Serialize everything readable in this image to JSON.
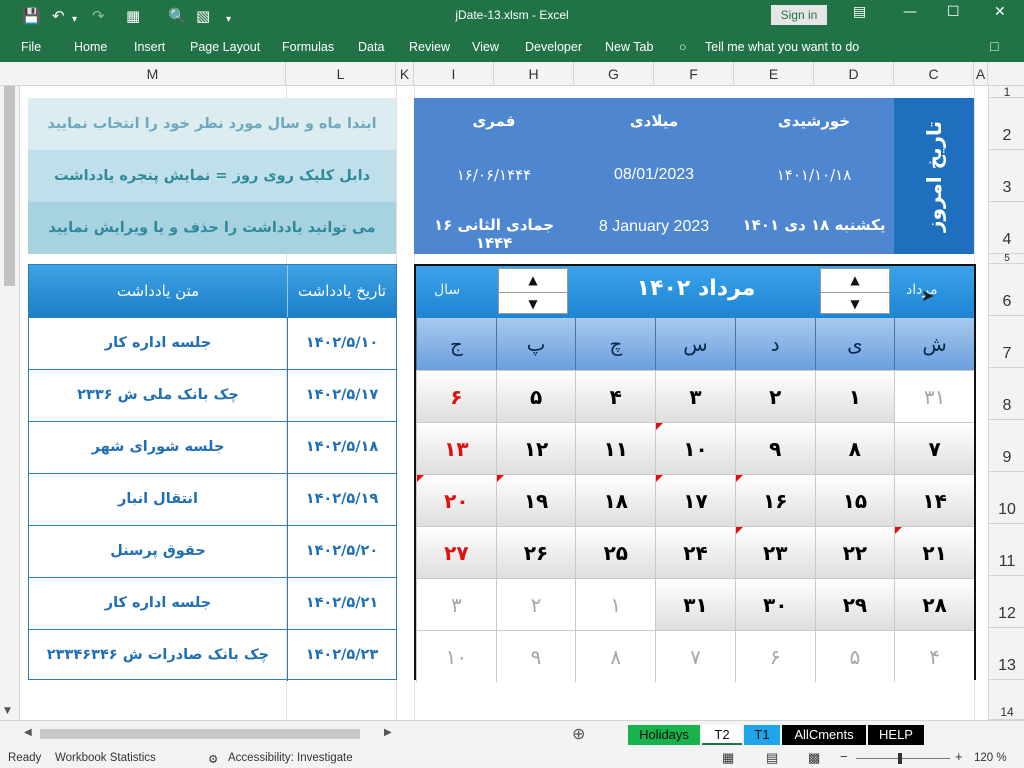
{
  "titlebar": {
    "title": "jDate-13.xlsm  -  Excel",
    "sign_in": "Sign in",
    "save_icon": "save-icon",
    "undo_icon": "undo-icon",
    "redo_icon": "redo-icon"
  },
  "ribbon": {
    "tabs": [
      "File",
      "Home",
      "Insert",
      "Page Layout",
      "Formulas",
      "Data",
      "Review",
      "View",
      "Developer",
      "New Tab"
    ],
    "tell_me": "Tell me what you want to do"
  },
  "columns": [
    "M",
    "L",
    "K",
    "I",
    "H",
    "G",
    "F",
    "E",
    "D",
    "C",
    "A"
  ],
  "rows": [
    "1",
    "2",
    "3",
    "4",
    "5",
    "6",
    "7",
    "8",
    "9",
    "10",
    "11",
    "12",
    "13",
    "14"
  ],
  "info": {
    "line1": "ابتدا ماه و سال مورد نظر خود را انتخاب نمایید",
    "line2": "دابل کلیک روی روز = نمایش پنجره یادداشت",
    "line3": "می توانید یادداشت را حذف و یا ویرایش نمایید"
  },
  "today": {
    "side_label": "تاریخ امروز",
    "head_shamsi": "خورشیدی",
    "head_miladi": "میلادی",
    "head_ghamari": "قمری",
    "shamsi_date": "۱۴۰۱/۱۰/۱۸",
    "miladi_date": "08/01/2023",
    "ghamari_date": "۱۶/۰۶/۱۴۴۴",
    "shamsi_text": "یکشنبه ۱۸ دی ۱۴۰۱",
    "miladi_text": "8 January 2023",
    "ghamari_text": "۱۶ جمادی الثانی ۱۴۴۴"
  },
  "notes": {
    "header_date": "تاریخ یادداشت",
    "header_text": "متن یادداشت",
    "rows": [
      {
        "date": "۱۴۰۲/۵/۱۰",
        "text": "جلسه اداره کار"
      },
      {
        "date": "۱۴۰۲/۵/۱۷",
        "text": "چک بانک ملی ش ۲۳۳۶"
      },
      {
        "date": "۱۴۰۲/۵/۱۸",
        "text": "جلسه شورای شهر"
      },
      {
        "date": "۱۴۰۲/۵/۱۹",
        "text": "انتقال انبار"
      },
      {
        "date": "۱۴۰۲/۵/۲۰",
        "text": "حقوق پرسنل"
      },
      {
        "date": "۱۴۰۲/۵/۲۱",
        "text": "جلسه اداره کار"
      },
      {
        "date": "۱۴۰۲/۵/۲۳",
        "text": "چک بانک صادرات ش ۲۳۳۴۶۳۴۶"
      }
    ]
  },
  "calendar": {
    "month_label": "مرداد",
    "year_label": "سال",
    "title": "مرداد ۱۴۰۲",
    "spin_up": "▲",
    "spin_down": "▼",
    "day_names": [
      "ش",
      "ی",
      "د",
      "س",
      "چ",
      "پ",
      "ج"
    ],
    "weeks": [
      [
        "۳۱",
        "۱",
        "۲",
        "۳",
        "۴",
        "۵",
        "۶"
      ],
      [
        "۷",
        "۸",
        "۹",
        "۱۰",
        "۱۱",
        "۱۲",
        "۱۳"
      ],
      [
        "۱۴",
        "۱۵",
        "۱۶",
        "۱۷",
        "۱۸",
        "۱۹",
        "۲۰"
      ],
      [
        "۲۱",
        "۲۲",
        "۲۳",
        "۲۴",
        "۲۵",
        "۲۶",
        "۲۷"
      ],
      [
        "۲۸",
        "۲۹",
        "۳۰",
        "۳۱",
        "۱",
        "۲",
        "۳"
      ],
      [
        "۴",
        "۵",
        "۶",
        "۷",
        "۸",
        "۹",
        "۱۰"
      ]
    ],
    "gray_cells": [
      "0-0",
      "4-4",
      "4-5",
      "4-6",
      "5-0",
      "5-1",
      "5-2",
      "5-3",
      "5-4",
      "5-5",
      "5-6"
    ],
    "red_cells": [
      "0-6",
      "1-6",
      "2-6",
      "3-6"
    ],
    "tagged_cells": [
      "1-3",
      "2-2",
      "2-3",
      "2-5",
      "2-6",
      "3-0",
      "3-2"
    ],
    "colors": {
      "header": "#1d85d2",
      "holiday": "#e01010"
    }
  },
  "sheets": [
    "Holidays",
    "T2",
    "T1",
    "AllCments",
    "HELP"
  ],
  "status": {
    "ready": "Ready",
    "workbook_stats": "Workbook Statistics",
    "accessibility": "Accessibility: Investigate",
    "zoom": "120 %"
  }
}
